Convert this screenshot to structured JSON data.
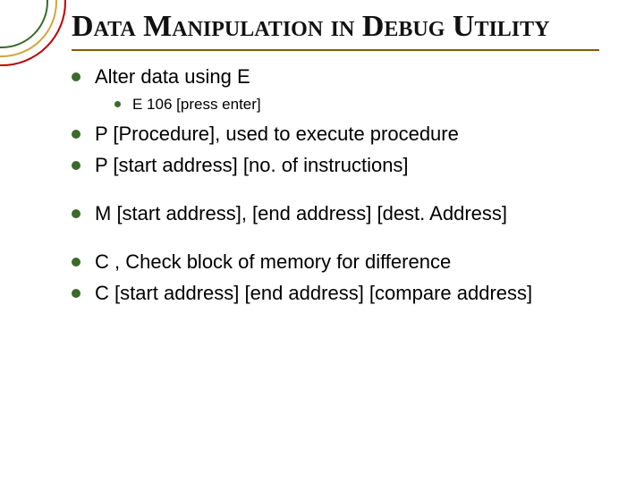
{
  "title": "Data Manipulation in Debug Utility",
  "bullets": {
    "b1": "Alter data using E",
    "b1_sub": "E 106 [press enter]",
    "b2": "P [Procedure], used to execute procedure",
    "b3": "P [start address] [no. of instructions]",
    "b4": "M [start address], [end address] [dest. Address]",
    "b5": "C , Check block of memory for difference",
    "b6": "C [start address] [end address] [compare address]"
  }
}
